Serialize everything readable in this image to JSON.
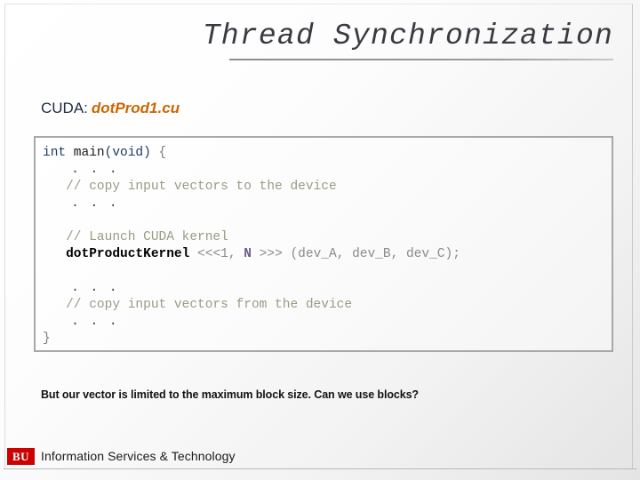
{
  "slide": {
    "title": "Thread Synchronization",
    "subtitle": {
      "lead": "CUDA:",
      "filename": "dotProd1.cu"
    },
    "code": {
      "line1_kw": "int",
      "line1_fn": " main",
      "line1_args": "(void)",
      "line1_brace": " {",
      "line2_dots": "   . . .",
      "line3_comment": "   // copy input vectors to the device",
      "line4_dots": "   . . .",
      "line6_comment": "   // Launch CUDA kernel",
      "line7_indent": "   ",
      "line7_fn": "dotProductKernel",
      "line7_chev_open": " <<<1, ",
      "line7_var": "N",
      "line7_chev_close": " >>> ",
      "line7_args": "(dev_A, dev_B, dev_C);",
      "line9_dots": "   . . .",
      "line10_comment": "   // copy input vectors from the device",
      "line11_dots": "   . . .",
      "line12_brace": "}"
    },
    "note": "But our vector is limited to the maximum block size. Can we use blocks?",
    "footer": {
      "logo": "BU",
      "text": "Information Services & Technology"
    },
    "colors": {
      "accent_orange": "#cc6600",
      "brand_red": "#cc0000",
      "title_gray": "#3a3a42",
      "comment_olive": "#9a9a86",
      "keyword_navy": "#1f3864",
      "var_purple": "#6b5b8a"
    }
  }
}
